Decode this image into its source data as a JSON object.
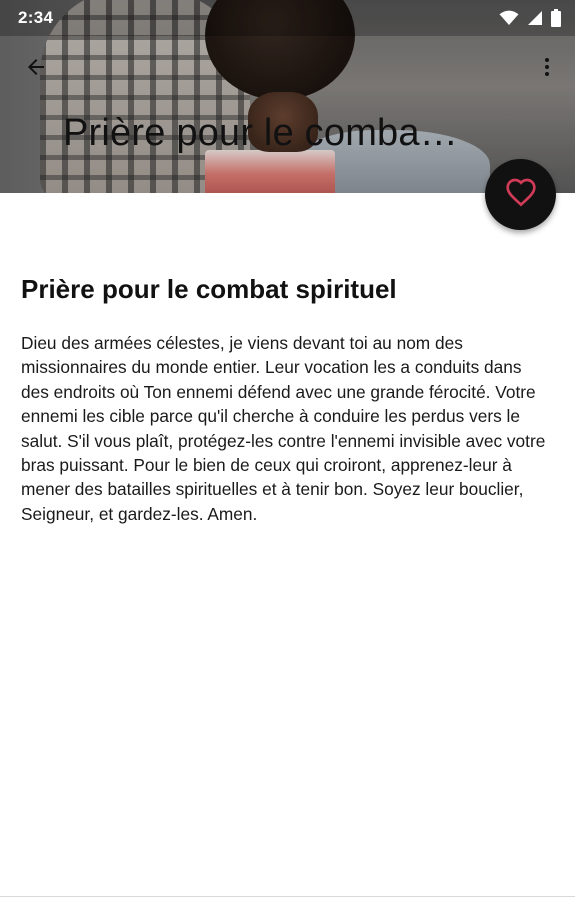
{
  "status_bar": {
    "time": "2:34"
  },
  "toolbar": {
    "back_icon": "arrow-back-icon",
    "more_icon": "more-vert-icon",
    "title": "Prière pour le comba…"
  },
  "fab": {
    "icon": "heart-outline-icon",
    "color": "#d23b58"
  },
  "prayer": {
    "title": "Prière pour le combat spirituel",
    "body": "Dieu des armées célestes, je viens devant toi au nom des missionnaires du monde entier. Leur vocation les a conduits dans des endroits où Ton ennemi défend avec une grande férocité. Votre ennemi les cible parce qu'il cherche à conduire les perdus vers le salut. S'il vous plaît, protégez-les contre l'ennemi invisible avec votre bras puissant. Pour le bien de ceux qui croiront, apprenez-leur à mener des batailles spirituelles et à tenir bon. Soyez leur bouclier, Seigneur, et gardez-les. Amen."
  }
}
